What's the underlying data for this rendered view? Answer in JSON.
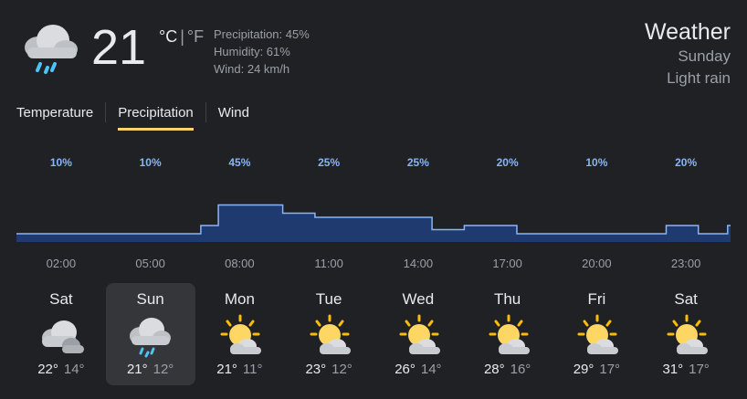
{
  "current": {
    "temperature": "21",
    "unit_c": "°C",
    "unit_f": "°F",
    "unit_separator": "|",
    "icon": "rain-cloud-icon",
    "precipitation": "Precipitation: 45%",
    "humidity": "Humidity: 61%",
    "wind": "Wind: 24 km/h"
  },
  "header": {
    "title": "Weather",
    "day": "Sunday",
    "condition": "Light rain"
  },
  "tabs": [
    {
      "label": "Temperature",
      "active": false
    },
    {
      "label": "Precipitation",
      "active": true
    },
    {
      "label": "Wind",
      "active": false
    }
  ],
  "colors": {
    "accent": "#fdd663",
    "bar_fill": "#1e3a6e",
    "bar_line": "#8ab4f8",
    "background": "#202124"
  },
  "chart_data": {
    "type": "area",
    "x": [
      "02:00",
      "05:00",
      "08:00",
      "11:00",
      "14:00",
      "17:00",
      "20:00",
      "23:00"
    ],
    "values": [
      10,
      10,
      45,
      25,
      25,
      20,
      10,
      20
    ],
    "labels": [
      "10%",
      "10%",
      "45%",
      "25%",
      "25%",
      "20%",
      "10%",
      "20%"
    ],
    "ylim": [
      0,
      100
    ],
    "profile": [
      10,
      10,
      10,
      10,
      10,
      10,
      10,
      10,
      10,
      10,
      10,
      10,
      10,
      10,
      10,
      10,
      10,
      10,
      10,
      10,
      10,
      10,
      10,
      10,
      10,
      10,
      10,
      10,
      10,
      10,
      10,
      10,
      10,
      10,
      10,
      10,
      10,
      10,
      10,
      10,
      10,
      10,
      10,
      10,
      10,
      10,
      10,
      10,
      10,
      10,
      10,
      10,
      10,
      10,
      10,
      10,
      10,
      10,
      10,
      10,
      10,
      10,
      10,
      20,
      20,
      20,
      20,
      20,
      20,
      45,
      45,
      45,
      45,
      45,
      45,
      45,
      45,
      45,
      45,
      45,
      45,
      45,
      45,
      45,
      45,
      45,
      45,
      45,
      45,
      45,
      45,
      35,
      35,
      35,
      35,
      35,
      35,
      35,
      35,
      35,
      35,
      35,
      30,
      30,
      30,
      30,
      30,
      30,
      30,
      30,
      30,
      30,
      30,
      30,
      30,
      30,
      30,
      30,
      30,
      30,
      30,
      30,
      30,
      30,
      30,
      30,
      30,
      30,
      30,
      30,
      30,
      30,
      30,
      30,
      30,
      30,
      30,
      30,
      30,
      30,
      30,
      30,
      15,
      15,
      15,
      15,
      15,
      15,
      15,
      15,
      15,
      15,
      15,
      20,
      20,
      20,
      20,
      20,
      20,
      20,
      20,
      20,
      20,
      20,
      20,
      20,
      20,
      20,
      20,
      20,
      20,
      10,
      10,
      10,
      10,
      10,
      10,
      10,
      10,
      10,
      10,
      10,
      10,
      10,
      10,
      10,
      10,
      10,
      10,
      10,
      10,
      10,
      10,
      10,
      10,
      10,
      10,
      10,
      10,
      10,
      10,
      10,
      10,
      10,
      10,
      10,
      10,
      10,
      10,
      10,
      10,
      10,
      10,
      10,
      10,
      10,
      10,
      10,
      10,
      10,
      10,
      10,
      20,
      20,
      20,
      20,
      20,
      20,
      20,
      20,
      20,
      20,
      20,
      10,
      10,
      10,
      10,
      10,
      10,
      10,
      10,
      10,
      10,
      20
    ]
  },
  "days": [
    {
      "name": "Sat",
      "icon": "cloudy-icon",
      "high": "22°",
      "low": "14°",
      "selected": false
    },
    {
      "name": "Sun",
      "icon": "rain-cloud-icon",
      "high": "21°",
      "low": "12°",
      "selected": true
    },
    {
      "name": "Mon",
      "icon": "partly-sunny-icon",
      "high": "21°",
      "low": "11°",
      "selected": false
    },
    {
      "name": "Tue",
      "icon": "partly-sunny-icon",
      "high": "23°",
      "low": "12°",
      "selected": false
    },
    {
      "name": "Wed",
      "icon": "partly-sunny-icon",
      "high": "26°",
      "low": "14°",
      "selected": false
    },
    {
      "name": "Thu",
      "icon": "partly-sunny-icon",
      "high": "28°",
      "low": "16°",
      "selected": false
    },
    {
      "name": "Fri",
      "icon": "partly-sunny-icon",
      "high": "29°",
      "low": "17°",
      "selected": false
    },
    {
      "name": "Sat",
      "icon": "partly-sunny-icon",
      "high": "31°",
      "low": "17°",
      "selected": false
    }
  ]
}
